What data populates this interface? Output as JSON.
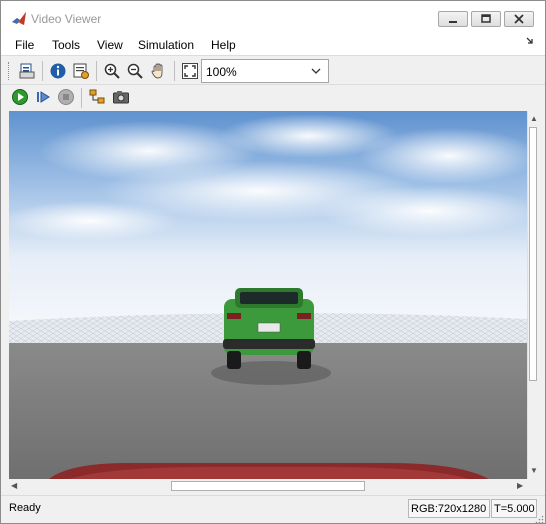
{
  "window": {
    "title": "Video Viewer",
    "icon": "matlab-logo-icon"
  },
  "menu": {
    "items": [
      "File",
      "Tools",
      "View",
      "Simulation",
      "Help"
    ],
    "overflow_icon": "overflow-arrow-icon"
  },
  "toolbar": {
    "icons": [
      "print-icon",
      "info-icon",
      "properties-icon",
      "zoom-in-icon",
      "zoom-out-icon",
      "pan-hand-icon",
      "fit-to-window-icon"
    ],
    "zoom": {
      "value": "100%"
    }
  },
  "simulation_toolbar": {
    "icons": [
      "run-icon",
      "step-forward-icon",
      "stop-icon",
      "highlight-block-icon",
      "snapshot-icon"
    ]
  },
  "viewer": {
    "content": "video-frame",
    "colors": {
      "sky_top": "#5f92cf",
      "car_body": "#3c9a3c",
      "ground": "#7c7c7c"
    }
  },
  "status": {
    "text": "Ready",
    "resolution": "RGB:720x1280",
    "time": "T=5.000"
  }
}
